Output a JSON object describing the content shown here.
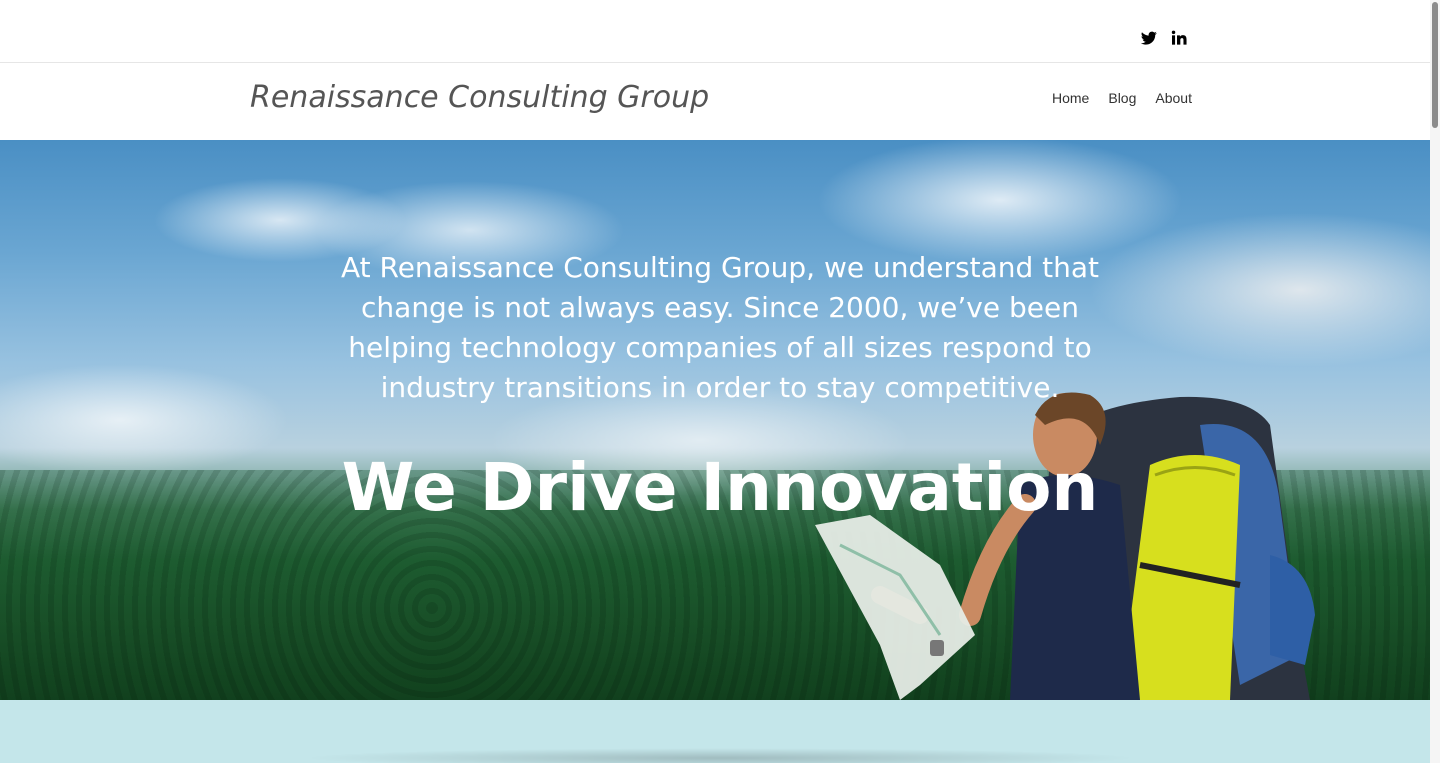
{
  "social": {
    "twitter_icon": "twitter-icon",
    "linkedin_icon": "linkedin-icon"
  },
  "header": {
    "logo": "Renaissance Consulting Group",
    "nav": [
      {
        "label": "Home"
      },
      {
        "label": "Blog"
      },
      {
        "label": "About"
      }
    ]
  },
  "hero": {
    "intro": "At Renaissance Consulting Group, we understand that change is not always easy. Since 2000, we’ve been helping technology companies of all sizes respond to industry transitions in order to stay competitive.",
    "title": "We Drive Innovation"
  },
  "colors": {
    "bottom_band": "#c4e6ea",
    "logo_text": "#555555",
    "nav_text": "#333333"
  }
}
